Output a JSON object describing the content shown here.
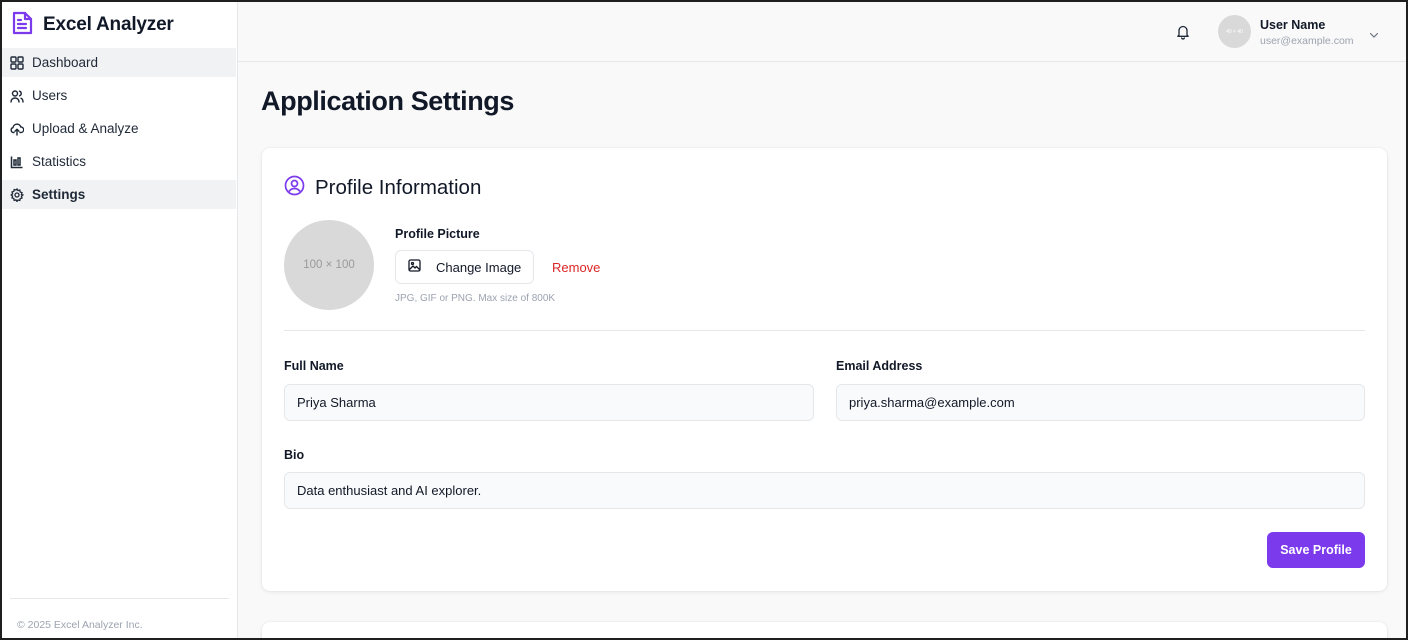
{
  "app": {
    "name": "Excel Analyzer",
    "footer": "© 2025 Excel Analyzer Inc."
  },
  "sidebar": {
    "items": [
      {
        "label": "Dashboard",
        "icon": "dashboard-grid-icon"
      },
      {
        "label": "Users",
        "icon": "users-icon"
      },
      {
        "label": "Upload & Analyze",
        "icon": "upload-cloud-icon"
      },
      {
        "label": "Statistics",
        "icon": "bar-chart-icon"
      },
      {
        "label": "Settings",
        "icon": "gear-icon",
        "active": true
      }
    ]
  },
  "topbar": {
    "avatar_placeholder": "40 × 40",
    "user_name": "User Name",
    "user_email": "user@example.com"
  },
  "page": {
    "title": "Application Settings"
  },
  "profile": {
    "section_title": "Profile Information",
    "picture_placeholder": "100 × 100",
    "picture_label": "Profile Picture",
    "change_image_label": "Change Image",
    "remove_label": "Remove",
    "picture_hint": "JPG, GIF or PNG. Max size of 800K",
    "full_name_label": "Full Name",
    "full_name_value": "Priya Sharma",
    "email_label": "Email Address",
    "email_value": "priya.sharma@example.com",
    "bio_label": "Bio",
    "bio_value": "Data enthusiast and AI explorer.",
    "save_label": "Save Profile"
  },
  "colors": {
    "accent": "#7c3aed",
    "danger": "#dc2626",
    "muted": "#9ca3af"
  }
}
